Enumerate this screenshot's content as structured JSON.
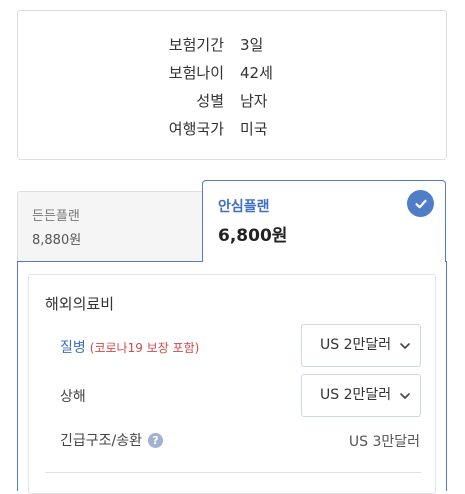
{
  "summary": {
    "rows": [
      {
        "label": "보험기간",
        "value": "3일"
      },
      {
        "label": "보험나이",
        "value": "42세"
      },
      {
        "label": "성별",
        "value": "남자"
      },
      {
        "label": "여행국가",
        "value": "미국"
      }
    ]
  },
  "plans": [
    {
      "name": "든든플랜",
      "price": "8,880원",
      "selected": false
    },
    {
      "name": "안심플랜",
      "price": "6,800원",
      "selected": true
    }
  ],
  "coverage": {
    "section_title": "해외의료비",
    "disease": {
      "label": "질병",
      "note": "(코로나19 보장 포함)",
      "selected": "US 2만달러"
    },
    "injury": {
      "label": "상해",
      "selected": "US 2만달러"
    },
    "emergency": {
      "label": "긴급구조/송환",
      "help": "?",
      "value": "US 3만달러"
    }
  },
  "colors": {
    "accent": "#4f7dc7",
    "note_red": "#d04b4b"
  },
  "icons": {
    "check": "check-circle-icon",
    "chevron": "chevron-down-icon",
    "help": "question-circle-icon"
  }
}
